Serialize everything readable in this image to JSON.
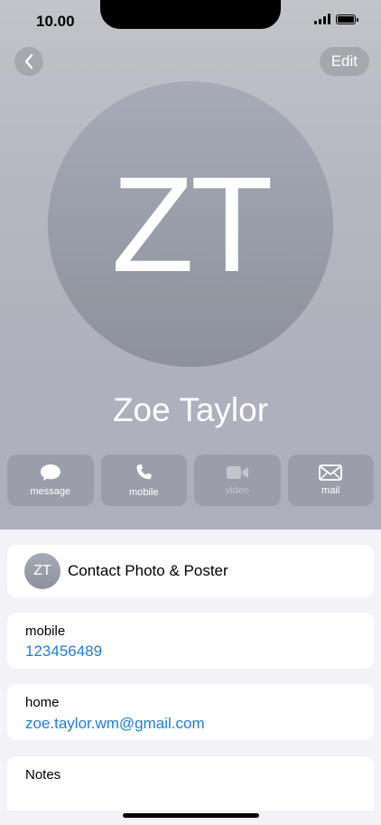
{
  "status": {
    "time": "10.00"
  },
  "nav": {
    "edit_label": "Edit"
  },
  "contact": {
    "initials": "ZT",
    "name": "Zoe Taylor"
  },
  "actions": [
    {
      "label": "message",
      "icon": "message-bubble-icon",
      "enabled": true
    },
    {
      "label": "mobile",
      "icon": "phone-icon",
      "enabled": true
    },
    {
      "label": "video",
      "icon": "video-camera-icon",
      "enabled": false
    },
    {
      "label": "mail",
      "icon": "envelope-icon",
      "enabled": true
    }
  ],
  "poster": {
    "initials": "ZT",
    "label": "Contact Photo & Poster"
  },
  "fields": [
    {
      "label": "mobile",
      "value": "123456489"
    },
    {
      "label": "home",
      "value": "zoe.taylor.wm@gmail.com"
    }
  ],
  "notes": {
    "label": "Notes"
  },
  "colors": {
    "link": "#1a7fd9",
    "header_bg": "#b6b9c2"
  }
}
